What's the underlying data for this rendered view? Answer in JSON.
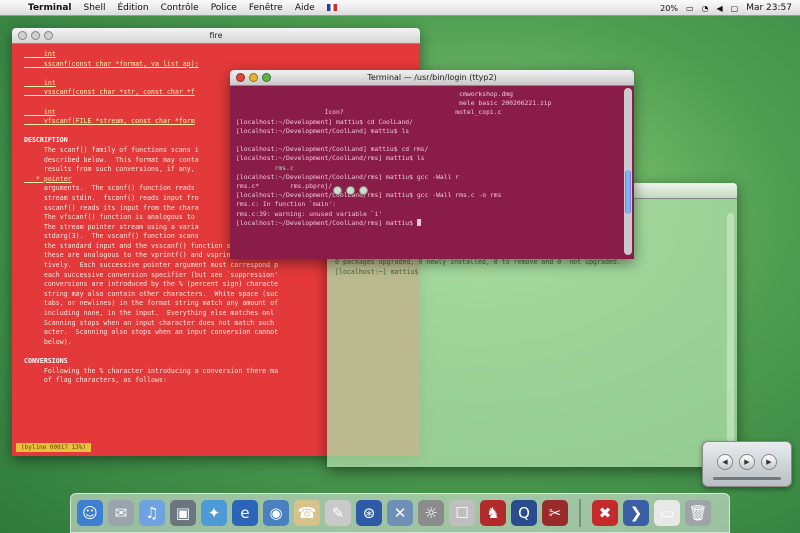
{
  "menubar": {
    "apple_icon": "apple-icon",
    "app_name": "Terminal",
    "items": [
      "Shell",
      "Édition",
      "Contrôle",
      "Police",
      "Fenêtre",
      "Aide"
    ],
    "battery": "20%",
    "clock": "Mar 23:57"
  },
  "man_window": {
    "title": "fire",
    "lines": [
      {
        "t": "     int",
        "c": "u"
      },
      {
        "t": "     sscanf(const char *format, va_list ap);",
        "c": "u"
      },
      {
        "t": "",
        "c": ""
      },
      {
        "t": "     int",
        "c": "u"
      },
      {
        "t": "     vsscanf(const char *str, const char *f",
        "c": "u"
      },
      {
        "t": "",
        "c": ""
      },
      {
        "t": "     int",
        "c": "u"
      },
      {
        "t": "     vfscanf(FILE *stream, const char *form",
        "c": "u"
      },
      {
        "t": "",
        "c": ""
      },
      {
        "t": "DESCRIPTION",
        "c": "h"
      },
      {
        "t": "     The scanf() family of functions scans i",
        "c": ""
      },
      {
        "t": "     described below.  This format may conta",
        "c": ""
      },
      {
        "t": "     results from such conversions, if any,",
        "c": ""
      },
      {
        "t": "   * pointer",
        "c": "u"
      },
      {
        "t": "     arguments.  The scanf() function reads",
        "c": ""
      },
      {
        "t": "     stream stdin.  fscanf() reads input fro",
        "c": ""
      },
      {
        "t": "     sscanf() reads its input from the chara",
        "c": ""
      },
      {
        "t": "     The vfscanf() function is analogous to",
        "c": ""
      },
      {
        "t": "     The stream pointer stream using a varia",
        "c": ""
      },
      {
        "t": "     stdarg(3).  The vscanf() function scans",
        "c": ""
      },
      {
        "t": "     the standard input and the vsscanf() function scans it from",
        "c": ""
      },
      {
        "t": "     these are analogous to the vprintf() and vsprintf() functio",
        "c": ""
      },
      {
        "t": "     tively.  Each successive pointer argument must correspond p",
        "c": ""
      },
      {
        "t": "     each successive conversion specifier (but see `suppression'",
        "c": ""
      },
      {
        "t": "     conversions are introduced by the % (percent sign) characte",
        "c": ""
      },
      {
        "t": "     string may also contain other characters.  White space (suc",
        "c": ""
      },
      {
        "t": "     tabs, or newlines) in the format string match any amount of",
        "c": ""
      },
      {
        "t": "     including none, in the input.  Everything else matches onl",
        "c": ""
      },
      {
        "t": "     Scanning stops when an input character does not match such",
        "c": ""
      },
      {
        "t": "     acter.  Scanning also stops when an input conversion cannot",
        "c": ""
      },
      {
        "t": "     below).",
        "c": ""
      },
      {
        "t": "",
        "c": ""
      },
      {
        "t": "CONVERSIONS",
        "c": "h"
      },
      {
        "t": "     Following the % character introducing a conversion there ma",
        "c": ""
      },
      {
        "t": "     of flag characters, as follows:",
        "c": ""
      }
    ],
    "status": "(byline 00017 13%)"
  },
  "terminal_window": {
    "title": "Terminal — /usr/bin/login (ttyp2)",
    "lines": [
      {
        "t": "                                                          cmworkshop.dmg",
        "c": ""
      },
      {
        "t": "                                                          mele basic 200206221.zip",
        "c": ""
      },
      {
        "t": "                       Icon?                             motel_copi.c",
        "c": ""
      },
      {
        "t": "[localhost:~/Development] mattiu$ cd CoolLand/",
        "c": ""
      },
      {
        "t": "[localhost:~/Development/CoolLand] mattiu$ ls",
        "c": ""
      },
      {
        "t": "",
        "c": ""
      },
      {
        "t": "[localhost:~/Development/CoolLand] mattiu$ cd rms/",
        "c": ""
      },
      {
        "t": "[localhost:~/Development/CoolLand/rms] mattiu$ ls",
        "c": ""
      },
      {
        "t": "          rms.c",
        "c": "g"
      },
      {
        "t": "[localhost:~/Development/CoolLand/rms] mattiu$ gcc -Wall r",
        "c": ""
      },
      {
        "t": "rms.c*        rms.pbproj/",
        "c": ""
      },
      {
        "t": "[localhost:~/Development/CoolLand/rms] mattiu$ gcc -Wall rms.c -o rms",
        "c": ""
      },
      {
        "t": "rms.c: In function `main':",
        "c": ""
      },
      {
        "t": "rms.c:39: warning: unused variable `i'",
        "c": ""
      },
      {
        "t": "[localhost:~/Development/CoolLand/rms] mattiu$ ",
        "c": "cur"
      }
    ]
  },
  "green_window": {
    "lines": [
      "Building Dependency Tree... Done",
      "Sorry, ssh is already the newest version.",
      "0 packages upgraded, 0 newly installed, 0 to remove and 0  not upgraded.",
      "[localhost:~] mattiu$"
    ]
  },
  "dock": {
    "icons": [
      {
        "name": "finder-icon",
        "glyph": "☺",
        "bg": "#3f7fd1"
      },
      {
        "name": "mail-icon",
        "glyph": "✉",
        "bg": "#9aa4ad"
      },
      {
        "name": "itunes-icon",
        "glyph": "♫",
        "bg": "#6fa3e0"
      },
      {
        "name": "iphoto-icon",
        "glyph": "▣",
        "bg": "#6b7680"
      },
      {
        "name": "imovie-icon",
        "glyph": "✦",
        "bg": "#4d9ad6"
      },
      {
        "name": "internet-explorer-icon",
        "glyph": "e",
        "bg": "#2b64b8"
      },
      {
        "name": "sherlock-icon",
        "glyph": "◉",
        "bg": "#4a7fc0"
      },
      {
        "name": "ichat-icon",
        "glyph": "☎",
        "bg": "#d6c28a"
      },
      {
        "name": "text-edit-icon",
        "glyph": "✎",
        "bg": "#c9c9c9"
      },
      {
        "name": "network-icon",
        "glyph": "⊛",
        "bg": "#2f5aa8"
      },
      {
        "name": "utilities-icon",
        "glyph": "✕",
        "bg": "#6e8fb6"
      },
      {
        "name": "photo-app-icon",
        "glyph": "☼",
        "bg": "#8b8b8b"
      },
      {
        "name": "preview-icon",
        "glyph": "☐",
        "bg": "#bfbfbf"
      },
      {
        "name": "chess-icon",
        "glyph": "♞",
        "bg": "#b22a2a"
      },
      {
        "name": "quicktime-icon",
        "glyph": "Q",
        "bg": "#2a4c8f"
      },
      {
        "name": "stuffit-icon",
        "glyph": "✂",
        "bg": "#9a2b2b"
      },
      {
        "name": "x11-icon",
        "glyph": "✖",
        "bg": "#c42a2a"
      },
      {
        "name": "terminal-icon",
        "glyph": "❯",
        "bg": "#3a5fa5"
      },
      {
        "name": "documents-icon",
        "glyph": "▭",
        "bg": "#e8e8e8"
      },
      {
        "name": "trash-icon",
        "glyph": "🗑",
        "bg": "#9ea4a8"
      }
    ]
  }
}
